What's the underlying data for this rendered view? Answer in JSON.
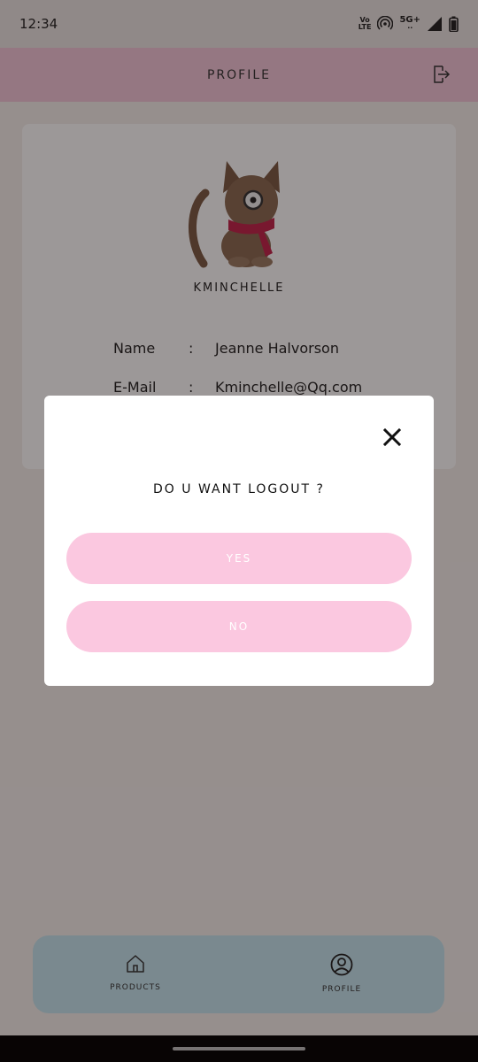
{
  "status_bar": {
    "time": "12:34",
    "volte_top": "Vo",
    "volte_bottom": "LTE",
    "network": "5G+",
    "icons": [
      "volte-lte-icon",
      "hotspot-icon",
      "network-5g-icon",
      "signal-icon",
      "battery-icon"
    ]
  },
  "header": {
    "title": "PROFILE",
    "logout_icon": "logout-icon"
  },
  "profile": {
    "avatar_icon": "cat-avatar-icon",
    "username": "KMINCHELLE",
    "fields": [
      {
        "label": "Name",
        "separator": ":",
        "value": "Jeanne Halvorson"
      },
      {
        "label": "E-Mail",
        "separator": ":",
        "value": "Kminchelle@Qq.com"
      }
    ]
  },
  "dialog": {
    "title": "DO U WANT LOGOUT ?",
    "yes_label": "YES",
    "no_label": "NO",
    "close_icon": "close-icon"
  },
  "bottom_nav": {
    "items": [
      {
        "label": "PRODUCTS",
        "icon": "home-icon"
      },
      {
        "label": "PROFILE",
        "icon": "profile-icon"
      }
    ]
  },
  "colors": {
    "header_bg": "#f3c7da",
    "button_bg": "#fbc8e0",
    "nav_bg": "#c4e6ef",
    "overlay": "rgba(20,10,10,0.42)"
  }
}
